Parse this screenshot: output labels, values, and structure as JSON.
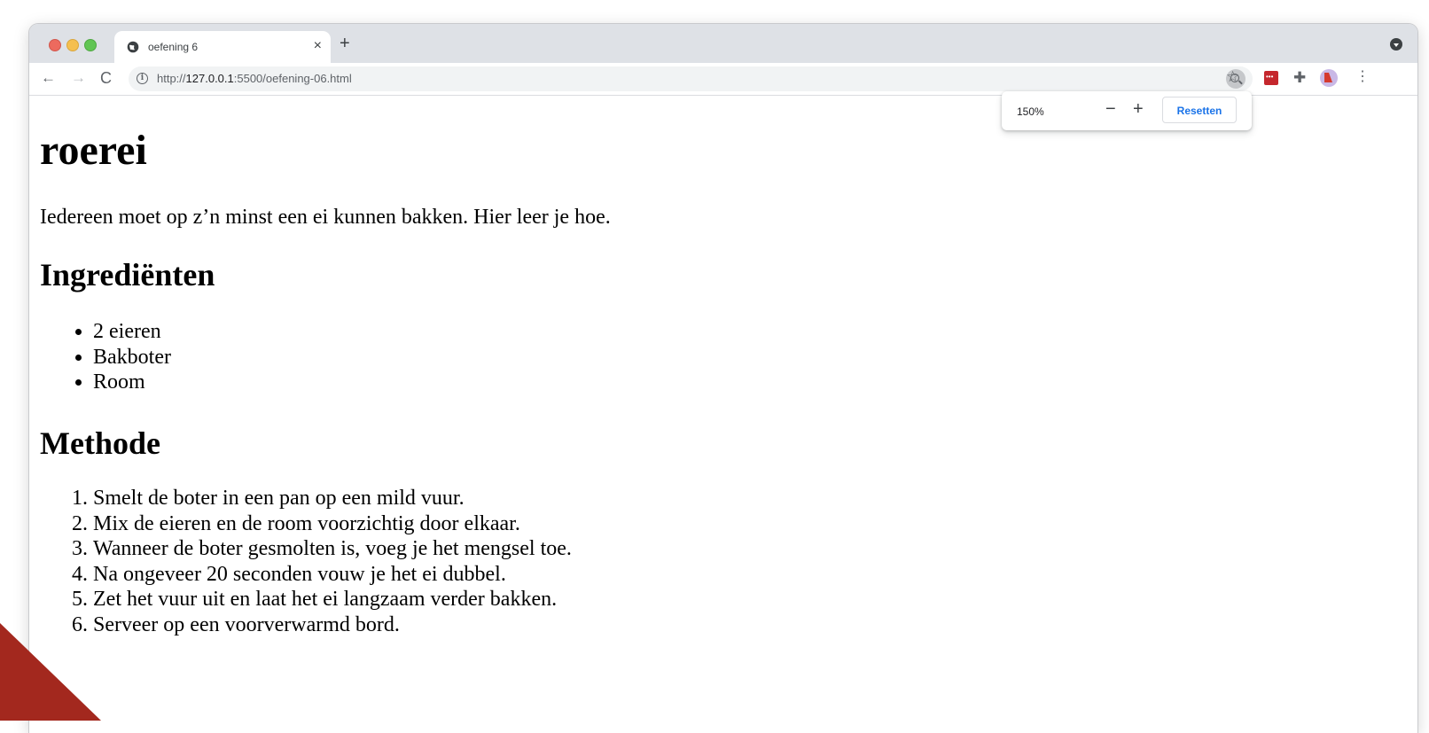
{
  "tab": {
    "title": "oefening 6",
    "close": "×",
    "new_tab": "+"
  },
  "toolbar": {
    "back": "←",
    "forward": "→",
    "reload": "C",
    "url_prefix": "http://",
    "url_host": "127.0.0.1",
    "url_path": ":5500/oefening-06.html",
    "star": "☆",
    "puzzle": "✚",
    "menu": "⋮"
  },
  "zoom_popup": {
    "level": "150%",
    "minus": "−",
    "plus": "+",
    "reset_label": "Resetten"
  },
  "page": {
    "title": "roerei",
    "intro": "Iedereen moet op z’n minst een ei kunnen bakken. Hier leer je hoe.",
    "ingredients_heading": "Ingrediënten",
    "ingredients": [
      "2 eieren",
      "Bakboter",
      "Room"
    ],
    "method_heading": "Methode",
    "steps": [
      "Smelt de boter in een pan op een mild vuur.",
      "Mix de eieren en de room voorzichtig door elkaar.",
      "Wanneer de boter gesmolten is, voeg je het mengsel toe.",
      "Na ongeveer 20 seconden vouw je het ei dubbel.",
      "Zet het vuur uit en laat het ei langzaam verder bakken.",
      "Serveer op een voorverwarmd bord."
    ]
  },
  "colors": {
    "accent_corner": "#a3281e",
    "zoom_reset_text": "#1a73e8",
    "tabstrip": "#dee1e6"
  }
}
